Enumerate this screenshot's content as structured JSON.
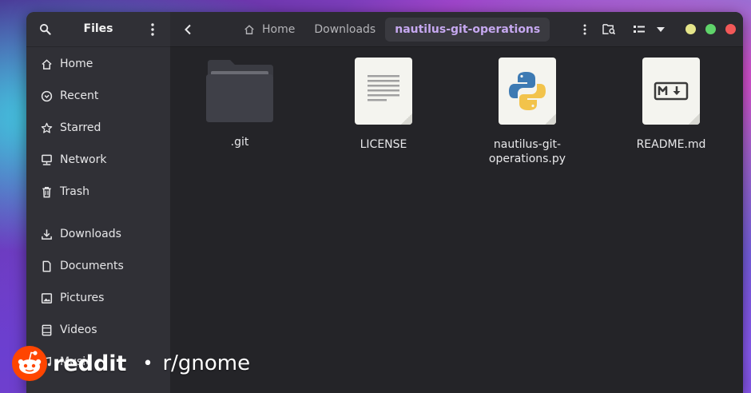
{
  "app": {
    "title": "Files"
  },
  "sidebar": {
    "items": [
      {
        "label": "Home",
        "icon": "home-icon"
      },
      {
        "label": "Recent",
        "icon": "clock-icon"
      },
      {
        "label": "Starred",
        "icon": "star-icon"
      },
      {
        "label": "Network",
        "icon": "network-icon"
      },
      {
        "label": "Trash",
        "icon": "trash-icon"
      }
    ],
    "places": [
      {
        "label": "Downloads",
        "icon": "download-icon"
      },
      {
        "label": "Documents",
        "icon": "document-icon"
      },
      {
        "label": "Pictures",
        "icon": "image-icon"
      },
      {
        "label": "Videos",
        "icon": "video-icon"
      },
      {
        "label": "Music",
        "icon": "music-icon"
      }
    ]
  },
  "breadcrumb": {
    "items": [
      "Home",
      "Downloads",
      "nautilus-git-operations"
    ]
  },
  "files": [
    {
      "name": ".git",
      "type": "folder"
    },
    {
      "name": "LICENSE",
      "type": "text"
    },
    {
      "name": "nautilus-git-\noperations.py",
      "type": "python"
    },
    {
      "name": "README.md",
      "type": "markdown"
    }
  ],
  "window_controls": {
    "minimize_color": "#e5e58a",
    "maximize_color": "#5fd36a",
    "close_color": "#f25858"
  },
  "watermark": {
    "brand": "reddit",
    "separator": "•",
    "subreddit": "r/gnome"
  },
  "colors": {
    "accent": "#c6a8f0",
    "reddit_orange": "#ff4500"
  }
}
